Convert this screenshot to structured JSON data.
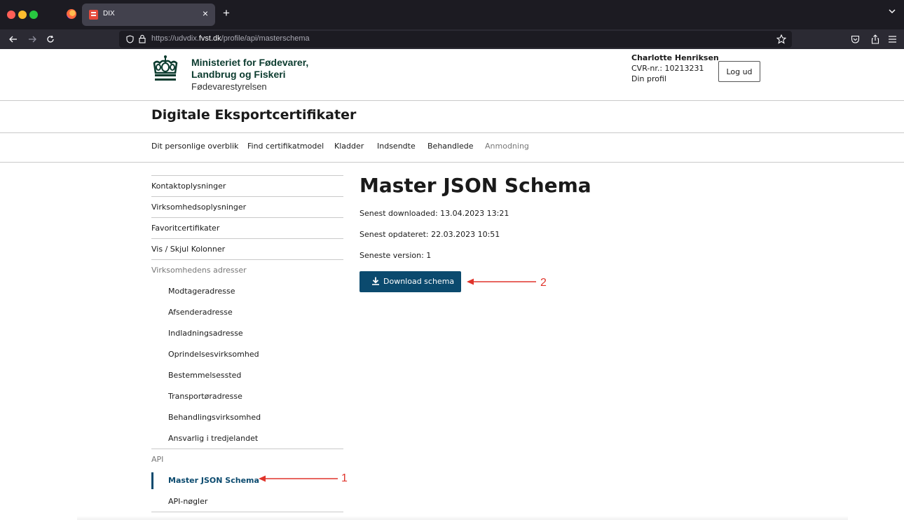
{
  "browser": {
    "tab_title": "DIX",
    "tab_close": "×",
    "new_tab": "+",
    "url_prefix": "https://udvdix.",
    "url_domain": "fvst.dk",
    "url_path": "/profile/api/masterschema",
    "icons": [
      "back-arrow-icon",
      "forward-arrow-icon",
      "reload-icon",
      "shield-icon",
      "lock-icon",
      "star-icon",
      "pocket-icon",
      "share-icon",
      "menu-icon"
    ]
  },
  "header": {
    "ministry_line1": "Ministeriet for Fødevarer,",
    "ministry_line2": "Landbrug og Fiskeri",
    "ministry_line3": "Fødevarestyrelsen",
    "user_name": "Charlotte Henriksen",
    "cvr": "CVR-nr.: 10213231",
    "profile_link": "Din profil",
    "logout_label": "Log ud",
    "brand_color": "#0b3b2e"
  },
  "site_title": "Digitale Eksportcertifikater",
  "main_nav": [
    {
      "label": "Dit personlige overblik"
    },
    {
      "label": "Find certifikatmodel"
    },
    {
      "label": "Kladder"
    },
    {
      "label": "Indsendte"
    },
    {
      "label": "Behandlede"
    },
    {
      "label": "Anmodning"
    }
  ],
  "sidemenu": {
    "items": [
      {
        "label": "Kontaktoplysninger"
      },
      {
        "label": "Virksomhedsoplysninger"
      },
      {
        "label": "Favoritcertifikater"
      },
      {
        "label": "Vis / Skjul Kolonner"
      },
      {
        "label": "Virksomhedens adresser"
      },
      {
        "label": "Modtageradresse"
      },
      {
        "label": "Afsenderadresse"
      },
      {
        "label": "Indladningsadresse"
      },
      {
        "label": "Oprindelsesvirksomhed"
      },
      {
        "label": "Bestemmelsessted"
      },
      {
        "label": "Transportøradresse"
      },
      {
        "label": "Behandlingsvirksomhed"
      },
      {
        "label": "Ansvarlig i tredjelandet"
      },
      {
        "label": "API"
      },
      {
        "label": "Master JSON Schema"
      },
      {
        "label": "API-nøgler"
      }
    ],
    "active_item": "Master JSON Schema"
  },
  "content": {
    "title": "Master JSON Schema",
    "last_downloaded": "Senest downloaded: 13.04.2023 13:21",
    "last_updated": "Senest opdateret: 22.03.2023 10:51",
    "latest_version": "Seneste version: 1",
    "download_label": "Download schema",
    "accent_color": "#0b4a6e"
  },
  "annotations": {
    "label_1": "1",
    "label_2": "2",
    "arrow_color": "#e0342b"
  }
}
